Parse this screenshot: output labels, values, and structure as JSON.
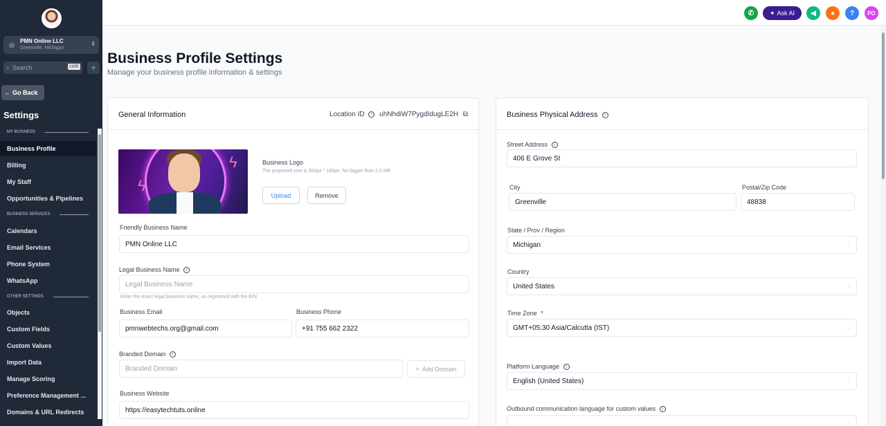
{
  "sidebar": {
    "account": {
      "name": "PMN Online LLC",
      "location": "Greenville, Michigan"
    },
    "search": {
      "placeholder": "Search",
      "shortcut": "ctrlK"
    },
    "go_back": "Go Back",
    "settings_title": "Settings",
    "sections": {
      "my_business": "MY BUSINESS",
      "business_services": "BUSINESS SERVICES",
      "other_settings": "OTHER SETTINGS"
    },
    "items": {
      "business_profile": "Business Profile",
      "billing": "Billing",
      "my_staff": "My Staff",
      "opportunities": "Opportunities & Pipelines",
      "calendars": "Calendars",
      "email_services": "Email Services",
      "phone_system": "Phone System",
      "whatsapp": "WhatsApp",
      "objects": "Objects",
      "custom_fields": "Custom Fields",
      "custom_values": "Custom Values",
      "import_data": "Import Data",
      "manage_scoring": "Manage Scoring",
      "preference_management": "Preference Management ...",
      "domains": "Domains & URL Redirects"
    }
  },
  "topbar": {
    "ask_ai": "Ask AI",
    "help": "?",
    "user_initials": "PO",
    "colors": {
      "phone": "#16a34a",
      "ask_ai": "#3b1d8f",
      "megaphone": "#10b981",
      "bell": "#f97316",
      "help": "#3b82f6",
      "user": "#d946ef"
    }
  },
  "page": {
    "title": "Business Profile Settings",
    "subtitle": "Manage your business profile information & settings"
  },
  "general": {
    "title": "General Information",
    "location_id_label": "Location ID",
    "location_id_value": "uhNhdiW7PygdIdugLE2H",
    "logo_label": "Business Logo",
    "logo_hint": "The proposed size is 350px * 180px. No bigger than 2.5 MB",
    "upload": "Upload",
    "remove": "Remove",
    "friendly_name_label": "Friendly Business Name",
    "friendly_name_value": "PMN Online LLC",
    "legal_name_label": "Legal Business Name",
    "legal_name_placeholder": "Legal Business Name",
    "legal_name_hint": "Enter the exact legal business name, as registered with the EIN",
    "email_label": "Business Email",
    "email_value": "pmnwebtechs.org@gmail.com",
    "phone_label": "Business Phone",
    "phone_value": "+91 755 662 2322",
    "branded_domain_label": "Branded Domain",
    "branded_domain_placeholder": "Branded Domain",
    "add_domain": "Add Domain",
    "website_label": "Business Website",
    "website_value": "https://easytechtuts.online"
  },
  "address": {
    "title": "Business Physical Address",
    "street_label": "Street Address",
    "street_value": "406 E Grove St",
    "city_label": "City",
    "city_value": "Greenville",
    "zip_label": "Postal/Zip Code",
    "zip_value": "48838",
    "state_label": "State / Prov / Region",
    "state_value": "Michigan",
    "country_label": "Country",
    "country_value": "United States",
    "timezone_label": "Time Zone",
    "timezone_required": "*",
    "timezone_value": "GMT+05:30 Asia/Calcutta (IST)",
    "platform_language_label": "Platform Language",
    "platform_language_value": "English (United States)",
    "outbound_language_label": "Outbound communication language for custom values"
  }
}
